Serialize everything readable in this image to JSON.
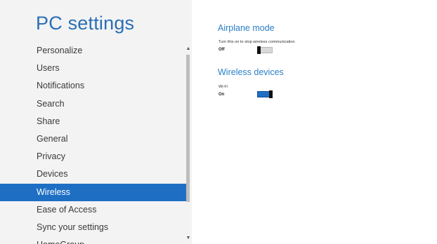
{
  "nav": {
    "title": "PC settings",
    "items": [
      {
        "label": "Personalize"
      },
      {
        "label": "Users"
      },
      {
        "label": "Notifications"
      },
      {
        "label": "Search"
      },
      {
        "label": "Share"
      },
      {
        "label": "General"
      },
      {
        "label": "Privacy"
      },
      {
        "label": "Devices"
      },
      {
        "label": "Wireless",
        "selected": true
      },
      {
        "label": "Ease of Access"
      },
      {
        "label": "Sync your settings"
      },
      {
        "label": "HomeGroup"
      }
    ],
    "scroll_up_icon": "chevron-up-icon",
    "scroll_down_icon": "chevron-down-icon"
  },
  "airplane": {
    "title": "Airplane mode",
    "caption": "Turn this on to stop wireless communication",
    "state_label": "Off",
    "is_on": false
  },
  "wireless": {
    "title": "Wireless devices",
    "wifi_label": "Wi-Fi",
    "state_label": "On",
    "is_on": true
  },
  "colors": {
    "accent": "#1e6fc4",
    "title_blue": "#2a6fb5",
    "nav_bg": "#f3f3f3"
  }
}
